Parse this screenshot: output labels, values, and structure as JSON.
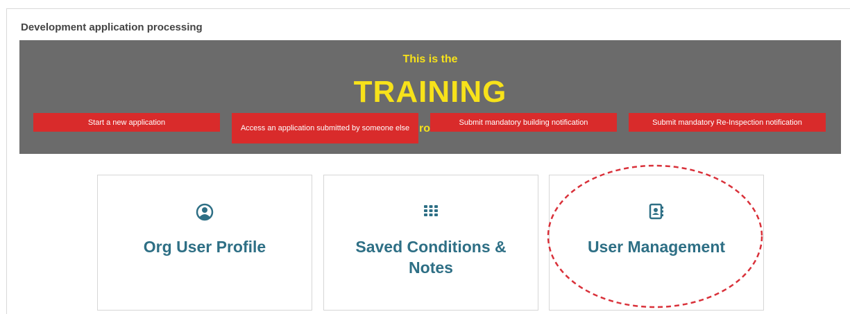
{
  "section": {
    "title": "Development application processing"
  },
  "banner": {
    "line1": "This is the",
    "line2": "TRAINING",
    "line3": "environment"
  },
  "actions": [
    {
      "label": "Start a new application"
    },
    {
      "label": "Access an application submitted by someone else"
    },
    {
      "label": "Submit mandatory building notification"
    },
    {
      "label": "Submit mandatory Re-Inspection notification"
    }
  ],
  "cards": [
    {
      "title": "Org User Profile",
      "icon": "user-circle-icon"
    },
    {
      "title": "Saved Conditions & Notes",
      "icon": "grid-icon"
    },
    {
      "title": "User Management",
      "icon": "address-book-icon"
    }
  ],
  "colors": {
    "banner_bg": "#6b6b6b",
    "banner_text": "#f7e21a",
    "action_button": "#d92b2b",
    "card_title": "#2e6f85",
    "annotation": "#d9313a"
  }
}
